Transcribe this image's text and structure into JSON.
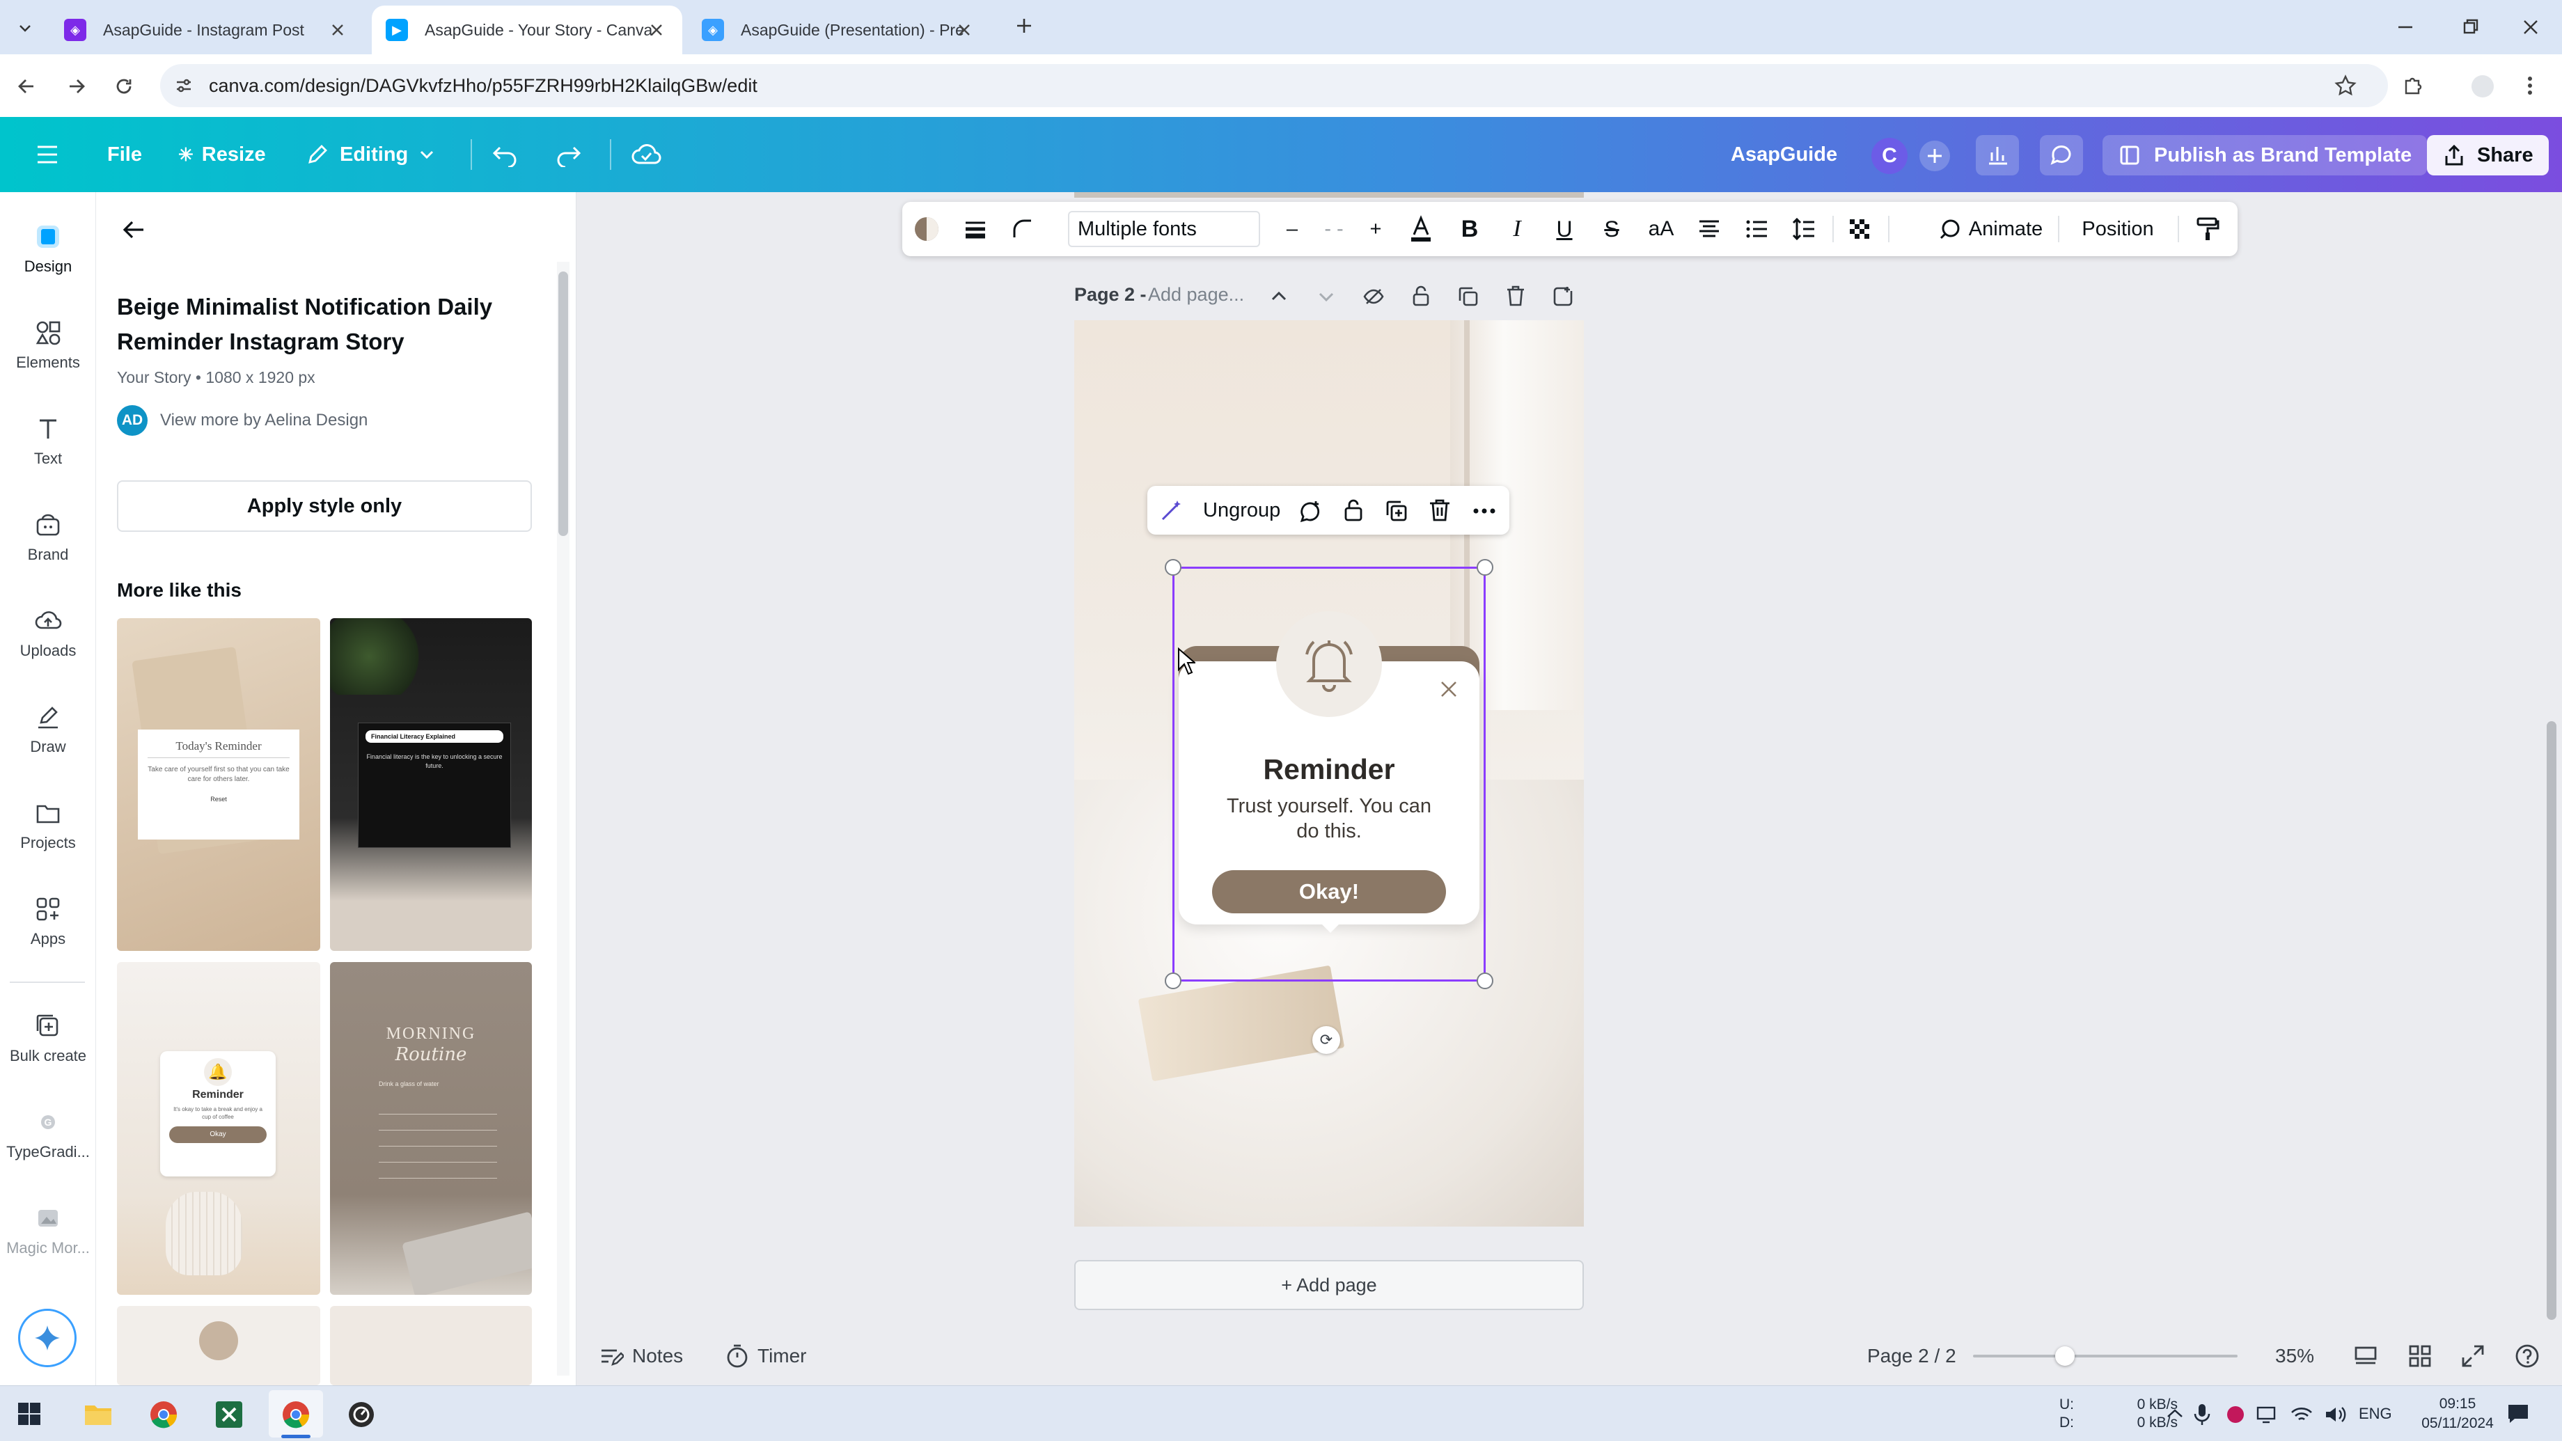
{
  "browser": {
    "tabs": [
      {
        "title": "AsapGuide - Instagram Post",
        "active": false
      },
      {
        "title": "AsapGuide - Your Story - Canva",
        "active": true
      },
      {
        "title": "AsapGuide (Presentation) - Pre",
        "active": false
      }
    ],
    "url": "canva.com/design/DAGVkvfzHho/p55FZRH99rbH2KlailqGBw/edit"
  },
  "header": {
    "file": "File",
    "resize": "Resize",
    "editing": "Editing",
    "brand_name": "AsapGuide",
    "avatar_letter": "C",
    "publish": "Publish as Brand Template",
    "share": "Share"
  },
  "rail": {
    "items": [
      {
        "label": "Design",
        "icon": "design-icon"
      },
      {
        "label": "Elements",
        "icon": "elements-icon"
      },
      {
        "label": "Text",
        "icon": "text-icon"
      },
      {
        "label": "Brand",
        "icon": "brand-icon"
      },
      {
        "label": "Uploads",
        "icon": "uploads-icon"
      },
      {
        "label": "Draw",
        "icon": "draw-icon"
      },
      {
        "label": "Projects",
        "icon": "projects-icon"
      },
      {
        "label": "Apps",
        "icon": "apps-icon"
      },
      {
        "label": "Bulk create",
        "icon": "bulk-create-icon"
      },
      {
        "label": "TypeGradi...",
        "icon": "typegradient-icon"
      },
      {
        "label": "Magic Mor...",
        "icon": "magic-morph-icon"
      }
    ]
  },
  "panel": {
    "title": "Beige Minimalist Notification Daily Reminder Instagram Story",
    "meta": "Your Story • 1080 x 1920 px",
    "author_initials": "AD",
    "author_link": "View more by Aelina Design",
    "apply_button": "Apply style only",
    "more_heading": "More like this",
    "thumbs": [
      {
        "heading": "Today's Reminder",
        "body": "Take care of yourself first so that you can take care for others later.",
        "button": "Reset"
      },
      {
        "heading": "Financial Literacy Explained",
        "body": "Financial literacy is the key to unlocking a secure future.",
        "button": ""
      },
      {
        "heading": "Reminder",
        "body": "It's okay to take a break and enjoy a cup of coffee",
        "button": "Okay"
      },
      {
        "heading": "MORNING",
        "script": "Routine",
        "body": "Drink a glass of water",
        "button": ""
      }
    ]
  },
  "toolbar": {
    "font": "Multiple fonts",
    "minus": "–",
    "size": "- -",
    "plus": "+",
    "animate": "Animate",
    "position": "Position"
  },
  "page": {
    "label": "Page 2 -",
    "placeholder": "Add page...",
    "add_page": "+ Add page"
  },
  "group_toolbar": {
    "ungroup": "Ungroup"
  },
  "design": {
    "title": "Reminder",
    "message": "Trust yourself. You can do this.",
    "button": "Okay!",
    "accent_color": "#8b7866"
  },
  "status": {
    "notes": "Notes",
    "timer": "Timer",
    "page_count": "Page 2 / 2",
    "zoom": "35%",
    "zoom_level": 0.35
  },
  "taskbar": {
    "net_up_label": "U:",
    "net_down_label": "D:",
    "net_up": "0 kB/s",
    "net_down": "0 kB/s",
    "lang": "ENG",
    "time": "09:15",
    "date": "05/11/2024"
  }
}
